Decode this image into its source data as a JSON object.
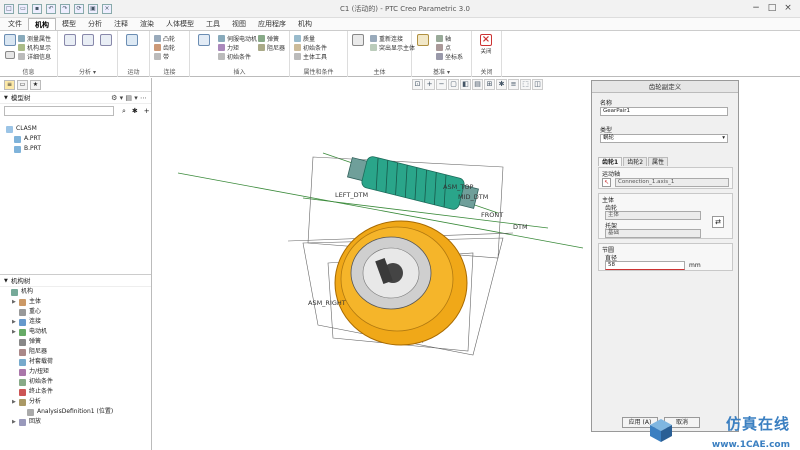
{
  "window": {
    "title": "C1 (活动的) - PTC Creo Parametric 3.0"
  },
  "tabs": [
    {
      "label": "文件",
      "active": false
    },
    {
      "label": "机构",
      "active": true
    },
    {
      "label": "模型",
      "active": false
    },
    {
      "label": "分析",
      "active": false
    },
    {
      "label": "注释",
      "active": false
    },
    {
      "label": "渲染",
      "active": false
    },
    {
      "label": "人体模型",
      "active": false
    },
    {
      "label": "工具",
      "active": false
    },
    {
      "label": "视图",
      "active": false
    },
    {
      "label": "应用程序",
      "active": false
    },
    {
      "label": "机构",
      "active": false
    }
  ],
  "ribbon": {
    "groups": [
      "信息",
      "分析",
      "运动",
      "连接",
      "插入",
      "属性和条件",
      "主体",
      "基准",
      "关闭"
    ],
    "group_arrows": [
      "分析 ▾",
      "基准 ▾"
    ],
    "small": {
      "measure": "测量属性",
      "detailed": "详细信息",
      "mech_display": "机构显示",
      "mass": "质量",
      "servo": "伺服电动机",
      "force": "力矩",
      "initial": "初始条件",
      "cam": "凸轮",
      "gear": "齿轮",
      "spring": "弹簧",
      "damper": "阻尼器",
      "belt": "带",
      "add_body": "重新连接",
      "define_body": "突出显示主体",
      "body_tools": "主体工具",
      "plane": "平面",
      "axis": "轴",
      "point": "点",
      "csys": "坐标系"
    },
    "close_label": "关闭"
  },
  "left_panel": {
    "model_tree_title": "模型树",
    "model_items": [
      "CLASM",
      "A.PRT",
      "B.PRT"
    ],
    "mech_tree_title": "机构树",
    "mech_items": [
      {
        "label": "机构",
        "expand": false,
        "indent": 0
      },
      {
        "label": "主体",
        "expand": true,
        "indent": 1
      },
      {
        "label": "重心",
        "expand": false,
        "indent": 1
      },
      {
        "label": "连接",
        "expand": true,
        "indent": 1
      },
      {
        "label": "电动机",
        "expand": true,
        "indent": 1
      },
      {
        "label": "弹簧",
        "expand": false,
        "indent": 1
      },
      {
        "label": "阻尼器",
        "expand": false,
        "indent": 1
      },
      {
        "label": "衬套载荷",
        "expand": false,
        "indent": 1
      },
      {
        "label": "力/扭矩",
        "expand": false,
        "indent": 1
      },
      {
        "label": "初始条件",
        "expand": false,
        "indent": 1
      },
      {
        "label": "终止条件",
        "expand": false,
        "indent": 1
      },
      {
        "label": "分析",
        "expand": true,
        "indent": 1
      },
      {
        "label": "AnalysisDefinition1 (位置)",
        "expand": false,
        "indent": 2
      },
      {
        "label": "回放",
        "expand": true,
        "indent": 1
      }
    ]
  },
  "canvas": {
    "datums": {
      "asm_top": "ASM_TOP",
      "mid_dtm": "MID_DTM",
      "left_dtm": "LEFT_DTM",
      "front": "FRONT",
      "dtm": "DTM",
      "asm_right": "ASM_RIGHT"
    },
    "colors": {
      "worm": "#2aa58a",
      "gear": "#f0a818",
      "hub": "#cfcfcf"
    }
  },
  "dialog": {
    "title": "齿轮副定义",
    "name_label": "名称",
    "name_value": "GearPair1",
    "type_label": "类型",
    "type_value": "蜗轮",
    "tabs": [
      "齿轮1",
      "齿轮2",
      "属性"
    ],
    "motion_axis_label": "运动轴",
    "motion_axis_value": "Connection_1.axis_1",
    "body_label": "主体",
    "gear_label": "齿轮",
    "gear_value": "主体",
    "carrier_label": "托架",
    "carrier_value": "基础",
    "pitch_label": "节圆",
    "diameter_label": "直径",
    "diameter_value": "58",
    "unit": "mm",
    "apply_label": "应用 (A)",
    "cancel_label": "取消"
  },
  "watermark": {
    "text": "仿真在线",
    "url": "www.1CAE.com"
  }
}
